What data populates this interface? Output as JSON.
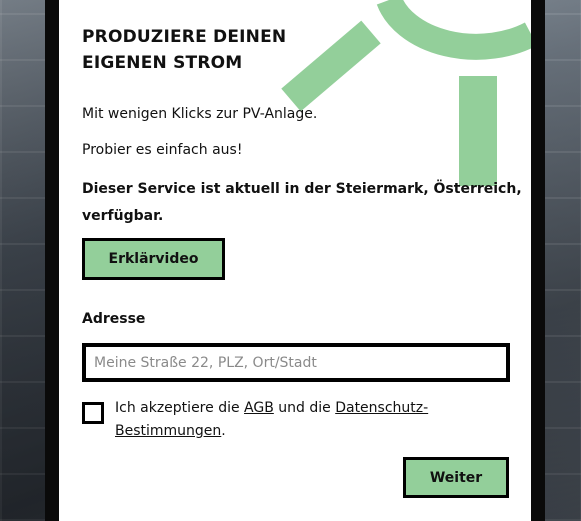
{
  "hero": {
    "title_line1": "PRODUZIERE DEINEN",
    "title_line2": "EIGENEN STROM",
    "intro": "Mit wenigen Klicks zur PV-Anlage.",
    "prompt": "Probier es einfach aus!",
    "availability": "Dieser Service ist aktuell in der Steiermark, Österreich, verfügbar."
  },
  "video_button": {
    "label": "Erklärvideo"
  },
  "address": {
    "label": "Adresse",
    "value": "",
    "placeholder": "Meine Straße 22, PLZ, Ort/Stadt"
  },
  "consent": {
    "checked": false,
    "text_before": "Ich akzeptiere die ",
    "agb_link": "AGB",
    "text_middle": " und die ",
    "privacy_link": "Datenschutz-Bestimmungen",
    "text_after": "."
  },
  "next_button": {
    "label": "Weiter"
  },
  "colors": {
    "accent_green": "#93cf9a",
    "border": "#000000",
    "card_bg": "#ffffff"
  },
  "decoration": {
    "icon": "sun-icon"
  }
}
